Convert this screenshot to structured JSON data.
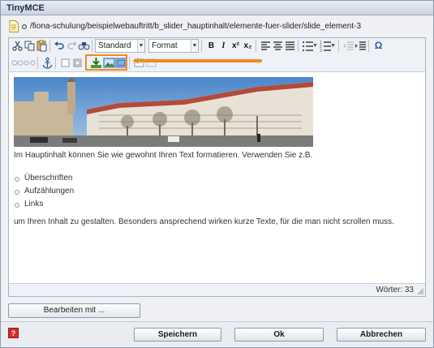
{
  "window": {
    "title": "TinyMCE"
  },
  "path": {
    "text": "/fiona-schulung/beispielwebauftritt/b_slider_hauptinhalt/elemente-fuer-slider/slide_element-3",
    "icon": "document-icon"
  },
  "toolbar": {
    "style_select": "Standard",
    "format_select": "Format",
    "bold_label": "B",
    "italic_label": "I",
    "superscript_label": "x²",
    "subscript_label": "x₂",
    "special_char_label": "Ω"
  },
  "content": {
    "paragraph1": "Im Hauptinhalt können Sie wie gewohnt Ihren Text formatieren. Verwenden Sie z.B.",
    "bullets": [
      "Überschriften",
      "Aufzählungen",
      "Links"
    ],
    "paragraph2": "um Ihren Inhalt zu gestalten. Besonders ansprechend wirken kurze Texte, für die man nicht scrollen muss."
  },
  "status": {
    "word_count": "Wörter: 33"
  },
  "buttons": {
    "edit_with": "Bearbeiten mit ...",
    "save": "Speichern",
    "ok": "Ok",
    "cancel": "Abbrechen",
    "help": "?"
  },
  "colors": {
    "highlight": "#f08a24",
    "help_red": "#d82b2b",
    "title_text": "#1d2b46"
  }
}
